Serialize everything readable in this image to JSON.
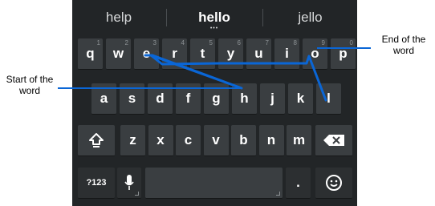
{
  "suggestions": [
    "help",
    "hello",
    "jello"
  ],
  "suggestion_more": "•••",
  "rows": [
    [
      {
        "k": "q",
        "h": "1"
      },
      {
        "k": "w",
        "h": "2"
      },
      {
        "k": "e",
        "h": "3"
      },
      {
        "k": "r",
        "h": "4"
      },
      {
        "k": "t",
        "h": "5"
      },
      {
        "k": "y",
        "h": "6"
      },
      {
        "k": "u",
        "h": "7"
      },
      {
        "k": "i",
        "h": "8"
      },
      {
        "k": "o",
        "h": "9"
      },
      {
        "k": "p",
        "h": "0"
      }
    ],
    [
      {
        "k": "a"
      },
      {
        "k": "s"
      },
      {
        "k": "d"
      },
      {
        "k": "f"
      },
      {
        "k": "g"
      },
      {
        "k": "h"
      },
      {
        "k": "j"
      },
      {
        "k": "k"
      },
      {
        "k": "l"
      }
    ],
    [
      {
        "k": "z"
      },
      {
        "k": "x"
      },
      {
        "k": "c"
      },
      {
        "k": "v"
      },
      {
        "k": "b"
      },
      {
        "k": "n"
      },
      {
        "k": "m"
      }
    ]
  ],
  "keys": {
    "numbers": "?123",
    "period": "."
  },
  "annotations": {
    "start": "Start of the word",
    "end": "End of the word"
  },
  "icons": {
    "shift": "shift-icon",
    "backspace": "backspace-icon",
    "mic": "mic-icon",
    "emoji": "emoji-icon"
  },
  "colors": {
    "keyboard_bg": "#222527",
    "key_bg": "#3a3e41",
    "trace": "#0a66d6",
    "callout_line": "#0a66d6"
  }
}
